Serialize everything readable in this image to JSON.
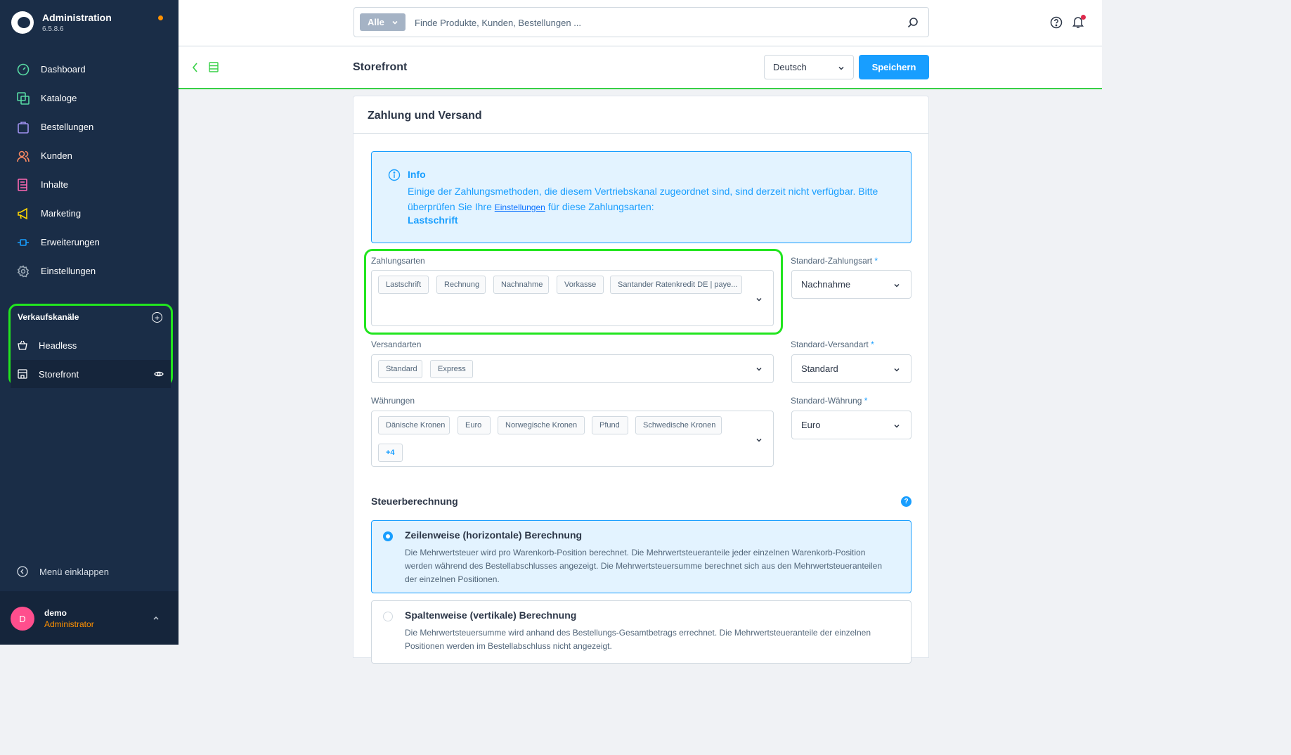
{
  "brand": {
    "title": "Administration",
    "version": "6.5.8.6"
  },
  "nav": [
    {
      "id": "dashboard",
      "label": "Dashboard",
      "color": "#57d9a3"
    },
    {
      "id": "kataloge",
      "label": "Kataloge",
      "color": "#57d9a3"
    },
    {
      "id": "bestellungen",
      "label": "Bestellungen",
      "color": "#a092f0"
    },
    {
      "id": "kunden",
      "label": "Kunden",
      "color": "#f88962"
    },
    {
      "id": "inhalte",
      "label": "Inhalte",
      "color": "#ff68b4"
    },
    {
      "id": "marketing",
      "label": "Marketing",
      "color": "#ffd700"
    },
    {
      "id": "erweiterungen",
      "label": "Erweiterungen",
      "color": "#189eff"
    },
    {
      "id": "einstellungen",
      "label": "Einstellungen",
      "color": "#9aa8b5"
    }
  ],
  "channels": {
    "title": "Verkaufskanäle",
    "items": [
      {
        "label": "Headless"
      },
      {
        "label": "Storefront"
      }
    ]
  },
  "sidebar_footer": {
    "collapse_label": "Menü einklappen",
    "user_initial": "D",
    "user_name": "demo",
    "user_role": "Administrator"
  },
  "search": {
    "type_label": "Alle",
    "placeholder": "Finde Produkte, Kunden, Bestellungen ..."
  },
  "smartbar": {
    "title": "Storefront",
    "language": "Deutsch",
    "save_label": "Speichern"
  },
  "card": {
    "title": "Zahlung und Versand",
    "info": {
      "title": "Info",
      "text_part1": "Einige der Zahlungsmethoden, die diesem Vertriebskanal zugeordnet sind, sind derzeit nicht verfügbar. Bitte überprüfen Sie Ihre ",
      "link": "Einstellungen",
      "text_part2": " für diese Zahlungsarten:",
      "bold": "Lastschrift"
    },
    "payment": {
      "label": "Zahlungsarten",
      "tags": [
        "Lastschrift",
        "Rechnung",
        "Nachnahme",
        "Vorkasse",
        "Santander Ratenkredit DE | paye..."
      ],
      "default_label": "Standard-Zahlungsart",
      "default_value": "Nachnahme"
    },
    "shipping": {
      "label": "Versandarten",
      "tags": [
        "Standard",
        "Express"
      ],
      "default_label": "Standard-Versandart",
      "default_value": "Standard"
    },
    "currency": {
      "label": "Währungen",
      "tags": [
        "Dänische Kronen",
        "Euro",
        "Norwegische Kronen",
        "Pfund",
        "Schwedische Kronen"
      ],
      "more": "+4",
      "default_label": "Standard-Währung",
      "default_value": "Euro"
    },
    "tax": {
      "title": "Steuerberechnung",
      "help": "?",
      "options": [
        {
          "title": "Zeilenweise (horizontale) Berechnung",
          "desc": "Die Mehrwertsteuer wird pro Warenkorb-Position berechnet. Die Mehrwertsteueranteile jeder einzelnen Warenkorb-Position werden während des Bestellabschlusses angezeigt. Die Mehrwertsteuersumme berechnet sich aus den Mehrwertsteueranteilen der einzelnen Positionen.",
          "selected": true
        },
        {
          "title": "Spaltenweise (vertikale) Berechnung",
          "desc": "Die Mehrwertsteuersumme wird anhand des Bestellungs-Gesamtbetrags errechnet. Die Mehrwertsteueranteile der einzelnen Positionen werden im Bestellabschluss nicht angezeigt.",
          "selected": false
        }
      ]
    }
  },
  "required_marker": "*",
  "colors": {
    "sidebar": "#1a2d47",
    "accent": "#189eff",
    "highlight": "#22e51f"
  }
}
